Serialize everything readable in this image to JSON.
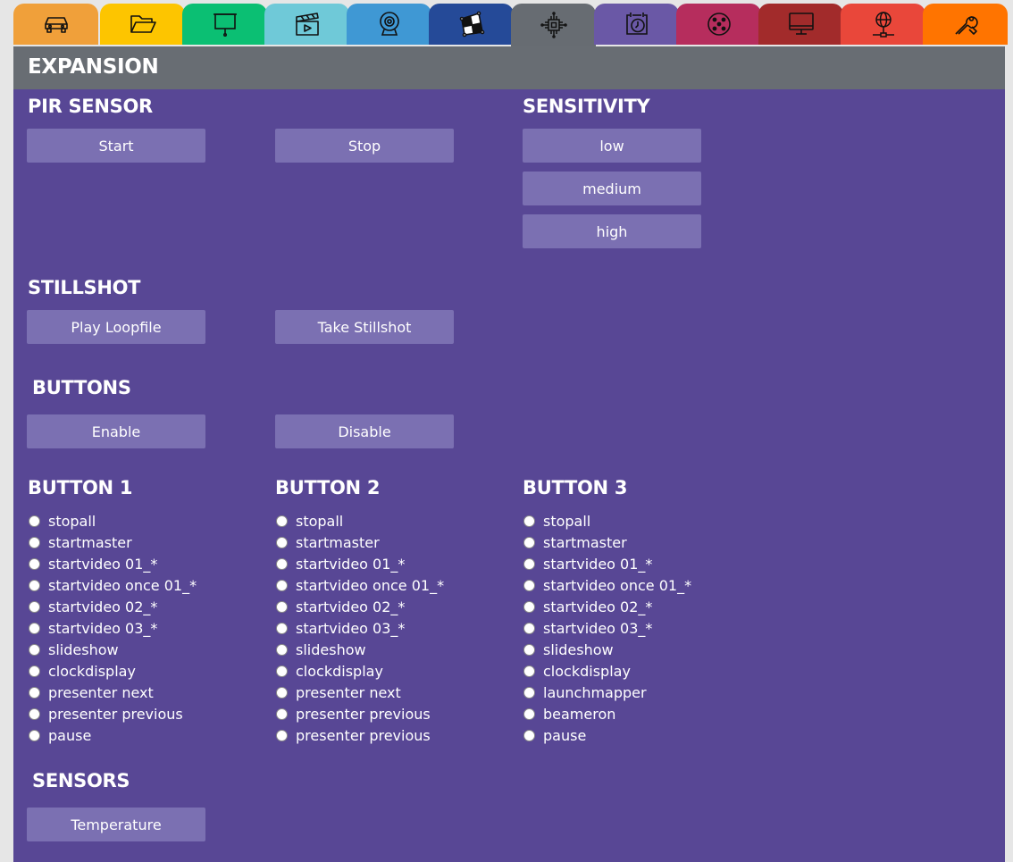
{
  "tabs": [
    {
      "icon": "car-icon",
      "color": "#f0a03a"
    },
    {
      "icon": "folder-icon",
      "color": "#fdc500"
    },
    {
      "icon": "projector-screen-icon",
      "color": "#0bbf73"
    },
    {
      "icon": "clapperboard-icon",
      "color": "#6fc9d8"
    },
    {
      "icon": "webcam-icon",
      "color": "#3f98d4"
    },
    {
      "icon": "projection-mapping-icon",
      "color": "#254a98"
    },
    {
      "icon": "chip-icon",
      "color": "#676c72"
    },
    {
      "icon": "calendar-clock-icon",
      "color": "#6a58a6"
    },
    {
      "icon": "dmx-connector-icon",
      "color": "#b62d5d"
    },
    {
      "icon": "monitor-icon",
      "color": "#a22b2b"
    },
    {
      "icon": "network-globe-icon",
      "color": "#e9473a"
    },
    {
      "icon": "tools-icon",
      "color": "#ff7400"
    }
  ],
  "active_tab": 6,
  "panel": {
    "title": "EXPANSION",
    "bg_color": "#584795",
    "header_color": "#686d73",
    "button_color": "#7b70b2"
  },
  "pir": {
    "title": "PIR SENSOR",
    "start": "Start",
    "stop": "Stop"
  },
  "sensitivity": {
    "title": "SENSITIVITY",
    "low": "low",
    "medium": "medium",
    "high": "high"
  },
  "stillshot": {
    "title": "STILLSHOT",
    "play": "Play Loopfile",
    "take": "Take Stillshot"
  },
  "buttons": {
    "title": "BUTTONS",
    "enable": "Enable",
    "disable": "Disable"
  },
  "button1": {
    "title": "BUTTON 1",
    "options": [
      "stopall",
      "startmaster",
      "startvideo 01_*",
      "startvideo once 01_*",
      "startvideo 02_*",
      "startvideo 03_*",
      "slideshow",
      "clockdisplay",
      "presenter next",
      "presenter previous",
      "pause"
    ]
  },
  "button2": {
    "title": "BUTTON 2",
    "options": [
      "stopall",
      "startmaster",
      "startvideo 01_*",
      "startvideo once 01_*",
      "startvideo 02_*",
      "startvideo 03_*",
      "slideshow",
      "clockdisplay",
      "presenter next",
      "presenter previous",
      "presenter previous"
    ]
  },
  "button3": {
    "title": "BUTTON 3",
    "options": [
      "stopall",
      "startmaster",
      "startvideo 01_*",
      "startvideo once 01_*",
      "startvideo 02_*",
      "startvideo 03_*",
      "slideshow",
      "clockdisplay",
      "launchmapper",
      "beameron",
      "pause"
    ]
  },
  "sensors": {
    "title": "SENSORS",
    "temperature": "Temperature"
  }
}
